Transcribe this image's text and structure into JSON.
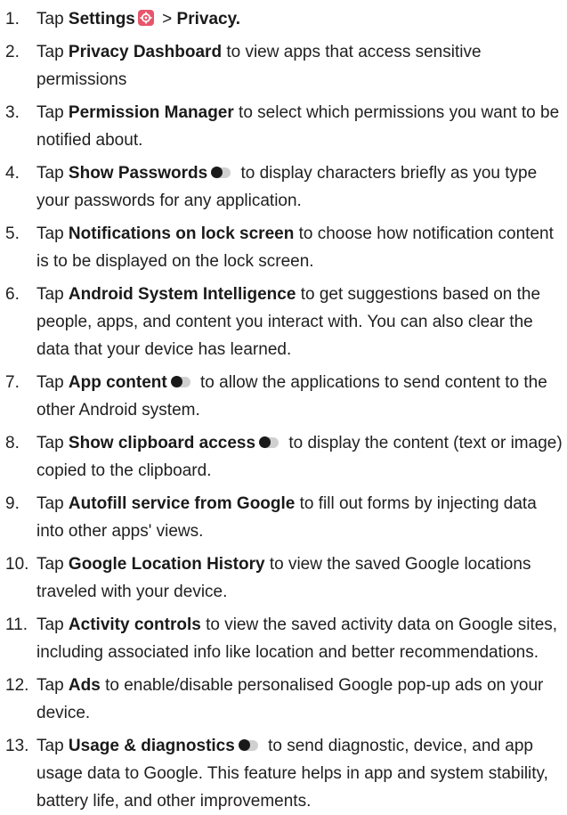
{
  "steps": [
    {
      "num": "1.",
      "pre": "Tap ",
      "bold": "Settings",
      "icon": "settings-gear-icon",
      "mid": " > ",
      "bold2": "Privacy.",
      "post": ""
    },
    {
      "num": "2.",
      "pre": "Tap ",
      "bold": "Privacy Dashboard",
      "post": " to view apps that access sensitive permissions"
    },
    {
      "num": "3.",
      "pre": "Tap ",
      "bold": "Permission Manager",
      "post": " to select which permissions you want to be notified about."
    },
    {
      "num": "4.",
      "pre": "Tap ",
      "bold": "Show Passwords",
      "icon": "toggle-icon",
      "post": " to display characters briefly as you type your passwords for any application."
    },
    {
      "num": "5.",
      "pre": "Tap ",
      "bold": "Notifications on lock screen",
      "post": " to choose how notification content is to be displayed on the lock screen."
    },
    {
      "num": "6.",
      "pre": "Tap ",
      "bold": "Android System Intelligence",
      "post": " to get suggestions based on the people, apps, and content you interact with. You can also clear the data that your device has learned."
    },
    {
      "num": "7.",
      "pre": "Tap ",
      "bold": "App content",
      "icon": "toggle-icon",
      "post": " to allow the applications to send content to the other Android system."
    },
    {
      "num": "8.",
      "pre": "Tap ",
      "bold": "Show clipboard access",
      "icon": "toggle-icon",
      "post": " to display the content (text or image) copied to the clipboard."
    },
    {
      "num": "9.",
      "pre": "Tap ",
      "bold": "Autofill service from Google",
      "post": " to fill out forms by injecting data into other apps' views."
    },
    {
      "num": "10.",
      "pre": "Tap ",
      "bold": "Google Location History",
      "post": " to view the saved Google locations traveled with your device."
    },
    {
      "num": "11.",
      "pre": "Tap ",
      "bold": "Activity controls",
      "post": " to view the saved activity data on Google sites, including associated info like location and better recommendations."
    },
    {
      "num": "12.",
      "pre": "Tap ",
      "bold": "Ads",
      "post": " to enable/disable personalised Google pop-up ads on your device."
    },
    {
      "num": "13.",
      "pre": "Tap ",
      "bold": "Usage & diagnostics",
      "icon": "toggle-icon",
      "post": " to send diagnostic, device, and app usage data to Google. This feature helps in app and system stability, battery life, and other improvements."
    }
  ]
}
